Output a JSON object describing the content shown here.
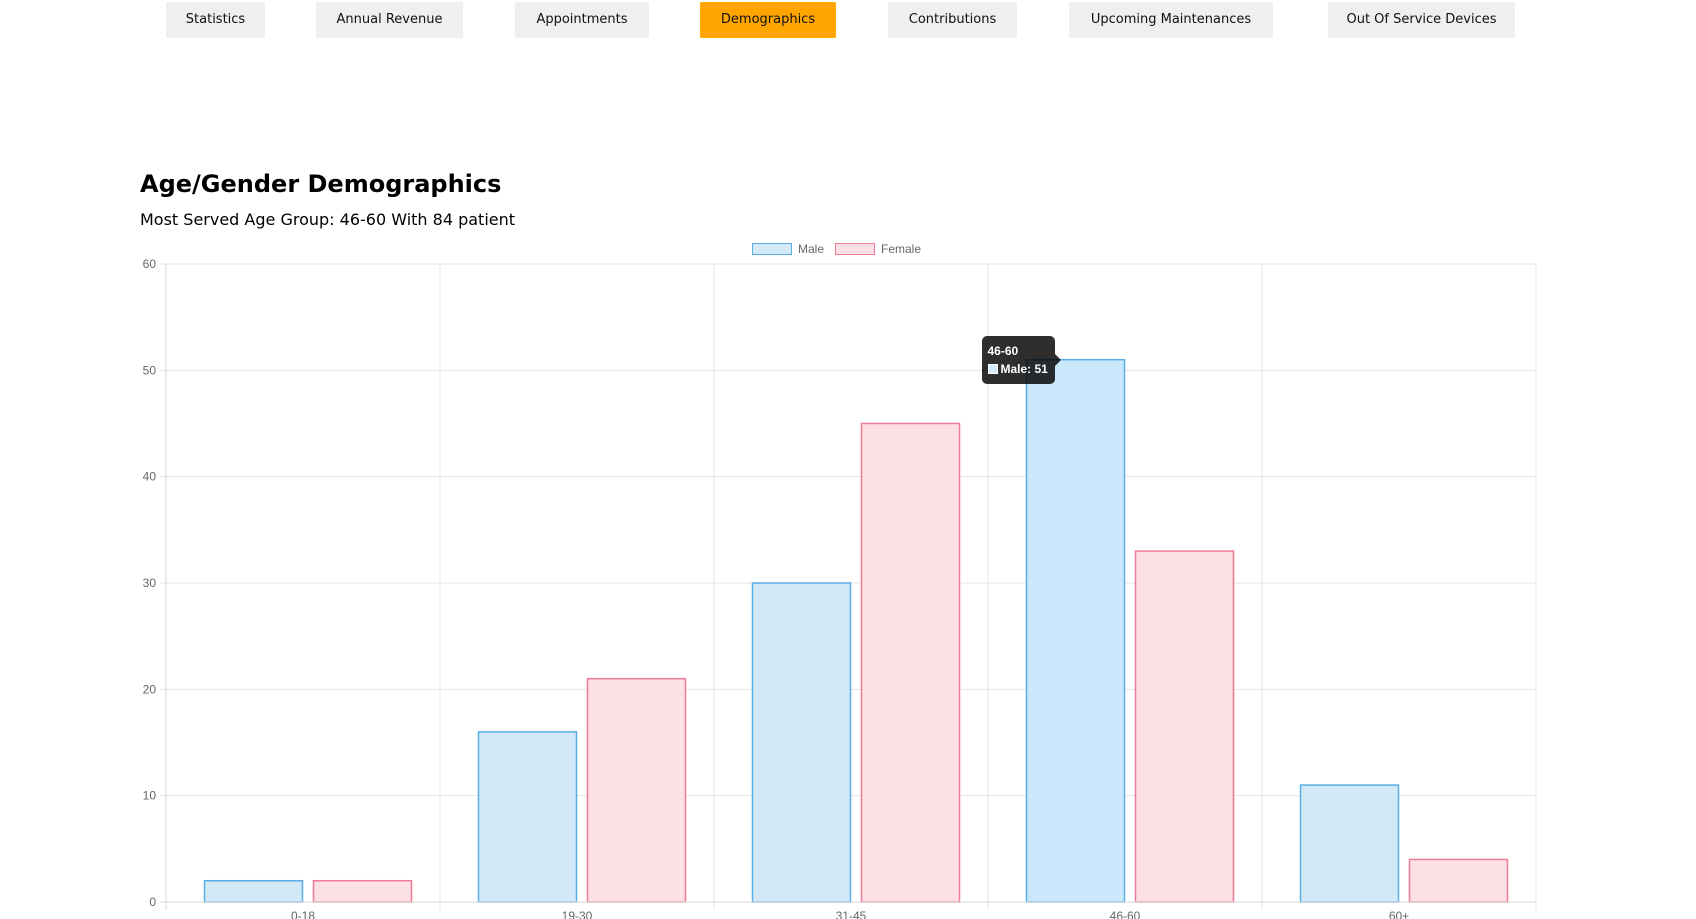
{
  "nav": {
    "tabs": [
      {
        "label": "Statistics",
        "active": false
      },
      {
        "label": "Annual Revenue",
        "active": false
      },
      {
        "label": "Appointments",
        "active": false
      },
      {
        "label": "Demographics",
        "active": true
      },
      {
        "label": "Contributions",
        "active": false
      },
      {
        "label": "Upcoming Maintenances",
        "active": false
      },
      {
        "label": "Out Of Service Devices",
        "active": false
      }
    ],
    "active_color": "#ffa500",
    "inactive_color": "#efefef"
  },
  "header": {
    "title": "Age/Gender Demographics",
    "subtitle": "Most Served Age Group: 46-60 With 84 patient"
  },
  "chart_data": {
    "type": "bar",
    "categories": [
      "0-18",
      "19-30",
      "31-45",
      "46-60",
      "60+"
    ],
    "series": [
      {
        "name": "Male",
        "values": [
          2,
          16,
          30,
          51,
          11
        ],
        "fill": "#d3e9f8",
        "stroke": "#5aaee6",
        "hover_fill": "#c9e8fb"
      },
      {
        "name": "Female",
        "values": [
          2,
          21,
          45,
          33,
          4
        ],
        "fill": "#fde0e6",
        "stroke": "#f07b96"
      }
    ],
    "ylim": [
      0,
      60
    ],
    "yticks": [
      0,
      10,
      20,
      30,
      40,
      50,
      60
    ],
    "grid": true,
    "legend_position": "top-center",
    "tooltip": {
      "title": "46-60",
      "label": "Male: 51",
      "category": "46-60",
      "series": "Male"
    }
  }
}
